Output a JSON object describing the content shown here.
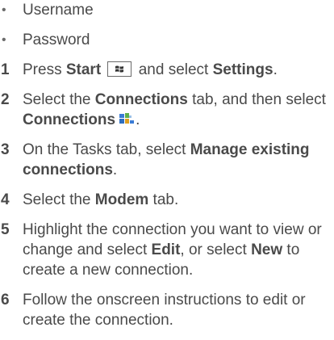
{
  "bullets": [
    {
      "text": "Username"
    },
    {
      "text": "Password"
    }
  ],
  "steps": [
    {
      "num": "1",
      "t1": "Press ",
      "b1": "Start",
      "t2": " and select ",
      "b2": "Settings",
      "t3": ".",
      "icon": "windows-start-icon"
    },
    {
      "num": "2",
      "t1": "Select the ",
      "b1": "Connections",
      "t2": " tab, and then select ",
      "b2": "Connections",
      "icon": "connections-icon",
      "t3": "."
    },
    {
      "num": "3",
      "t1": "On the Tasks tab, select ",
      "b1": "Manage existing connections",
      "t2": "."
    },
    {
      "num": "4",
      "t1": "Select the ",
      "b1": "Modem",
      "t2": " tab."
    },
    {
      "num": "5",
      "t1": "Highlight the connection you want to view or change and select ",
      "b1": "Edit",
      "t2": ", or select ",
      "b2": "New",
      "t3": " to create a new connection."
    },
    {
      "num": "6",
      "t1": "Follow the onscreen instructions to edit or create the connection."
    }
  ],
  "colors": {
    "text": "#4a4a4a",
    "background": "#ffffff"
  }
}
